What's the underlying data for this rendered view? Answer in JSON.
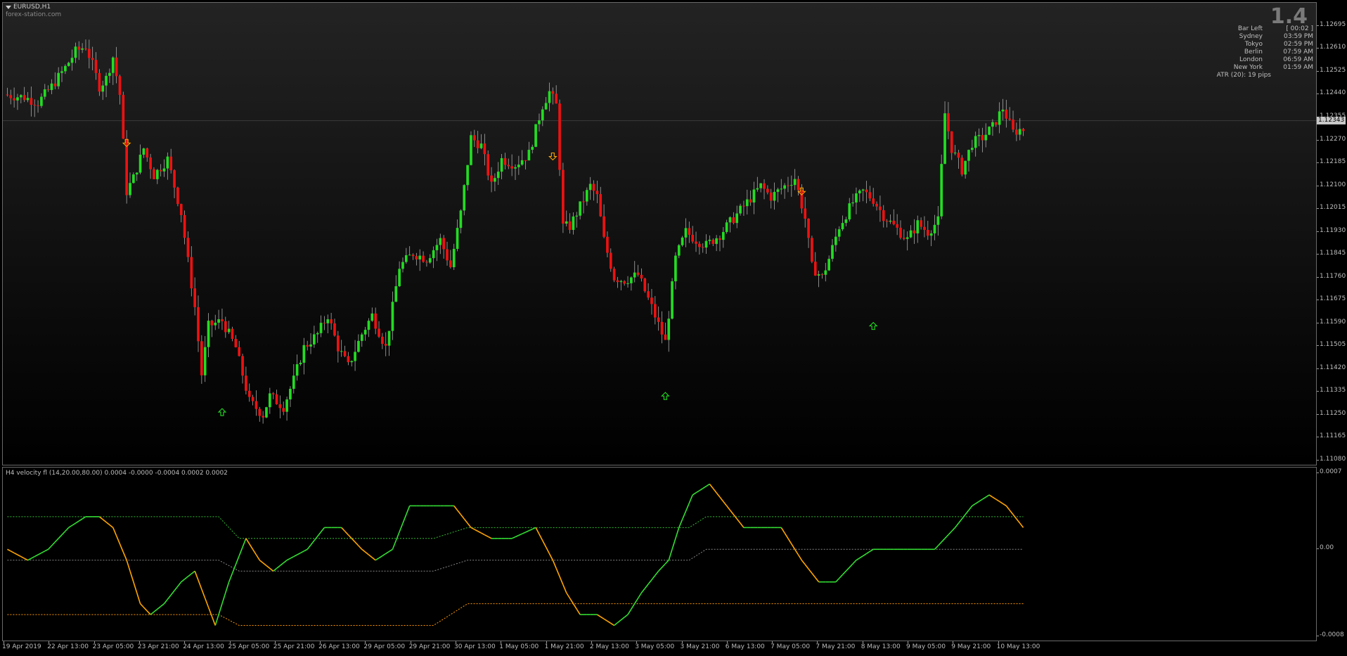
{
  "header": {
    "symbol": "EURUSD,H1",
    "watermark": "forex-station.com",
    "big_value": "1.4"
  },
  "info_panel": [
    {
      "label": "Bar Left",
      "value": "[ 00:02 ]"
    },
    {
      "label": "Sydney",
      "value": "03:59 PM"
    },
    {
      "label": "Tokyo",
      "value": "02:59 PM"
    },
    {
      "label": "Berlin",
      "value": "07:59 AM"
    },
    {
      "label": "London",
      "value": "06:59 AM"
    },
    {
      "label": "New York",
      "value": "01:59 AM"
    },
    {
      "label": "ATR (20): 19 pips",
      "value": ""
    }
  ],
  "price_scale": {
    "labels": [
      "1.12695",
      "1.12610",
      "1.12525",
      "1.12440",
      "1.12355",
      "1.12270",
      "1.12185",
      "1.12100",
      "1.12015",
      "1.11930",
      "1.11845",
      "1.11760",
      "1.11675",
      "1.11590",
      "1.11505",
      "1.11420",
      "1.11335",
      "1.11250",
      "1.11165",
      "1.11080"
    ],
    "current_price": "1.12343"
  },
  "indicator": {
    "title": "H4 velocity fl (14,20.00,80.00) 0.0004 -0.0000 -0.0004 0.0002 0.0002",
    "scale_labels": [
      "0.0007",
      "0.00",
      "-0.0008"
    ]
  },
  "time_axis": {
    "labels": [
      "19 Apr 2019",
      "22 Apr 13:00",
      "23 Apr 05:00",
      "23 Apr 21:00",
      "24 Apr 13:00",
      "25 Apr 05:00",
      "25 Apr 21:00",
      "26 Apr 13:00",
      "29 Apr 05:00",
      "29 Apr 21:00",
      "30 Apr 13:00",
      "1 May 05:00",
      "1 May 21:00",
      "2 May 13:00",
      "3 May 05:00",
      "3 May 21:00",
      "6 May 13:00",
      "7 May 05:00",
      "7 May 21:00",
      "8 May 13:00",
      "9 May 05:00",
      "9 May 21:00",
      "10 May 13:00"
    ]
  },
  "colors": {
    "bull": "#22dd22",
    "bear": "#ee1111",
    "wick": "#aaaaaa",
    "arrow_down": "#ffa500",
    "arrow_up": "#22dd22",
    "vel_up": "#33dd33",
    "vel_down": "#ffa500"
  },
  "chart_data": {
    "type": "candlestick",
    "price_range": [
      1.1108,
      1.1276
    ],
    "close_path": [
      [
        0,
        1.1244
      ],
      [
        6,
        1.1243
      ],
      [
        10,
        1.1241
      ],
      [
        14,
        1.1247
      ],
      [
        18,
        1.1254
      ],
      [
        21,
        1.126
      ],
      [
        24,
        1.1262
      ],
      [
        26,
        1.1255
      ],
      [
        28,
        1.1247
      ],
      [
        30,
        1.125
      ],
      [
        32,
        1.1258
      ],
      [
        34,
        1.1244
      ],
      [
        36,
        1.1208
      ],
      [
        38,
        1.1213
      ],
      [
        41,
        1.1224
      ],
      [
        44,
        1.1214
      ],
      [
        48,
        1.122
      ],
      [
        52,
        1.12
      ],
      [
        54,
        1.1182
      ],
      [
        56,
        1.1165
      ],
      [
        58,
        1.114
      ],
      [
        60,
        1.1158
      ],
      [
        64,
        1.116
      ],
      [
        68,
        1.115
      ],
      [
        72,
        1.113
      ],
      [
        76,
        1.1125
      ],
      [
        78,
        1.1132
      ],
      [
        82,
        1.1128
      ],
      [
        85,
        1.1138
      ],
      [
        88,
        1.115
      ],
      [
        92,
        1.1155
      ],
      [
        95,
        1.1162
      ],
      [
        98,
        1.115
      ],
      [
        101,
        1.1143
      ],
      [
        105,
        1.1155
      ],
      [
        108,
        1.1162
      ],
      [
        112,
        1.115
      ],
      [
        116,
        1.118
      ],
      [
        120,
        1.1185
      ],
      [
        124,
        1.1183
      ],
      [
        128,
        1.119
      ],
      [
        131,
        1.118
      ],
      [
        134,
        1.12
      ],
      [
        137,
        1.1228
      ],
      [
        140,
        1.1225
      ],
      [
        143,
        1.121
      ],
      [
        146,
        1.122
      ],
      [
        150,
        1.1218
      ],
      [
        154,
        1.1222
      ],
      [
        158,
        1.124
      ],
      [
        160,
        1.1245
      ],
      [
        162,
        1.124
      ],
      [
        164,
        1.1195
      ],
      [
        166,
        1.1195
      ],
      [
        170,
        1.1205
      ],
      [
        172,
        1.121
      ],
      [
        174,
        1.1206
      ],
      [
        176,
        1.119
      ],
      [
        179,
        1.1176
      ],
      [
        182,
        1.1175
      ],
      [
        186,
        1.1177
      ],
      [
        190,
        1.1165
      ],
      [
        194,
        1.1152
      ],
      [
        197,
        1.1183
      ],
      [
        200,
        1.1193
      ],
      [
        203,
        1.119
      ],
      [
        206,
        1.1188
      ],
      [
        210,
        1.1192
      ],
      [
        214,
        1.1198
      ],
      [
        218,
        1.1204
      ],
      [
        222,
        1.121
      ],
      [
        225,
        1.1206
      ],
      [
        228,
        1.1209
      ],
      [
        232,
        1.1213
      ],
      [
        235,
        1.1198
      ],
      [
        237,
        1.118
      ],
      [
        240,
        1.1176
      ],
      [
        242,
        1.1183
      ],
      [
        245,
        1.1195
      ],
      [
        249,
        1.1204
      ],
      [
        252,
        1.1208
      ],
      [
        255,
        1.1205
      ],
      [
        258,
        1.1199
      ],
      [
        262,
        1.1194
      ],
      [
        265,
        1.119
      ],
      [
        268,
        1.1196
      ],
      [
        271,
        1.1193
      ],
      [
        274,
        1.1197
      ],
      [
        276,
        1.1237
      ],
      [
        278,
        1.1224
      ],
      [
        281,
        1.1216
      ],
      [
        284,
        1.1226
      ],
      [
        287,
        1.1228
      ],
      [
        290,
        1.1232
      ],
      [
        293,
        1.1239
      ],
      [
        296,
        1.123
      ],
      [
        298,
        1.1231
      ]
    ],
    "arrows": [
      {
        "bar": 35,
        "dir": "down",
        "price": 1.1226
      },
      {
        "bar": 63,
        "dir": "up",
        "price": 1.1126
      },
      {
        "bar": 160,
        "dir": "down",
        "price": 1.1221
      },
      {
        "bar": 193,
        "dir": "up",
        "price": 1.1132
      },
      {
        "bar": 233,
        "dir": "down",
        "price": 1.1208
      },
      {
        "bar": 254,
        "dir": "up",
        "price": 1.1158
      }
    ],
    "indicator_range": [
      -0.0008,
      0.0007
    ],
    "velocity": [
      [
        0,
        0.0
      ],
      [
        6,
        -0.0001
      ],
      [
        12,
        0.0
      ],
      [
        18,
        0.0002
      ],
      [
        23,
        0.0003
      ],
      [
        27,
        0.0003
      ],
      [
        31,
        0.0002
      ],
      [
        35,
        -0.0001
      ],
      [
        39,
        -0.0005
      ],
      [
        42,
        -0.0006
      ],
      [
        46,
        -0.0005
      ],
      [
        51,
        -0.0003
      ],
      [
        55,
        -0.0002
      ],
      [
        61,
        -0.0007
      ],
      [
        65,
        -0.0003
      ],
      [
        70,
        0.0001
      ],
      [
        74,
        -0.0001
      ],
      [
        78,
        -0.0002
      ],
      [
        82,
        -0.0001
      ],
      [
        88,
        0.0
      ],
      [
        93,
        0.0002
      ],
      [
        98,
        0.0002
      ],
      [
        104,
        0.0
      ],
      [
        108,
        -0.0001
      ],
      [
        113,
        0.0
      ],
      [
        118,
        0.0004
      ],
      [
        122,
        0.0004
      ],
      [
        127,
        0.0004
      ],
      [
        131,
        0.0004
      ],
      [
        136,
        0.0002
      ],
      [
        142,
        0.0001
      ],
      [
        148,
        0.0001
      ],
      [
        155,
        0.0002
      ],
      [
        160,
        -0.0001
      ],
      [
        164,
        -0.0004
      ],
      [
        168,
        -0.0006
      ],
      [
        173,
        -0.0006
      ],
      [
        178,
        -0.0007
      ],
      [
        182,
        -0.0006
      ],
      [
        186,
        -0.0004
      ],
      [
        191,
        -0.0002
      ],
      [
        194,
        -0.0001
      ],
      [
        197,
        0.0002
      ],
      [
        201,
        0.0005
      ],
      [
        206,
        0.0006
      ],
      [
        211,
        0.0004
      ],
      [
        216,
        0.0002
      ],
      [
        222,
        0.0002
      ],
      [
        227,
        0.0002
      ],
      [
        233,
        -0.0001
      ],
      [
        238,
        -0.0003
      ],
      [
        243,
        -0.0003
      ],
      [
        249,
        -0.0001
      ],
      [
        254,
        0.0
      ],
      [
        260,
        0.0
      ],
      [
        266,
        0.0
      ],
      [
        272,
        0.0
      ],
      [
        278,
        0.0002
      ],
      [
        283,
        0.0004
      ],
      [
        288,
        0.0005
      ],
      [
        293,
        0.0004
      ],
      [
        298,
        0.0002
      ]
    ],
    "upper_band": [
      [
        0,
        0.0003
      ],
      [
        62,
        0.0003
      ],
      [
        68,
        0.0001
      ],
      [
        125,
        0.0001
      ],
      [
        135,
        0.0002
      ],
      [
        200,
        0.0002
      ],
      [
        205,
        0.0003
      ],
      [
        298,
        0.0003
      ]
    ],
    "mid_band": [
      [
        0,
        -0.0001
      ],
      [
        62,
        -0.0001
      ],
      [
        68,
        -0.0002
      ],
      [
        125,
        -0.0002
      ],
      [
        135,
        -0.0001
      ],
      [
        200,
        -0.0001
      ],
      [
        205,
        0.0
      ],
      [
        298,
        0.0
      ]
    ],
    "lower_band": [
      [
        0,
        -0.0006
      ],
      [
        62,
        -0.0006
      ],
      [
        68,
        -0.0007
      ],
      [
        125,
        -0.0007
      ],
      [
        135,
        -0.0005
      ],
      [
        200,
        -0.0005
      ],
      [
        205,
        -0.0005
      ],
      [
        298,
        -0.0005
      ]
    ]
  }
}
